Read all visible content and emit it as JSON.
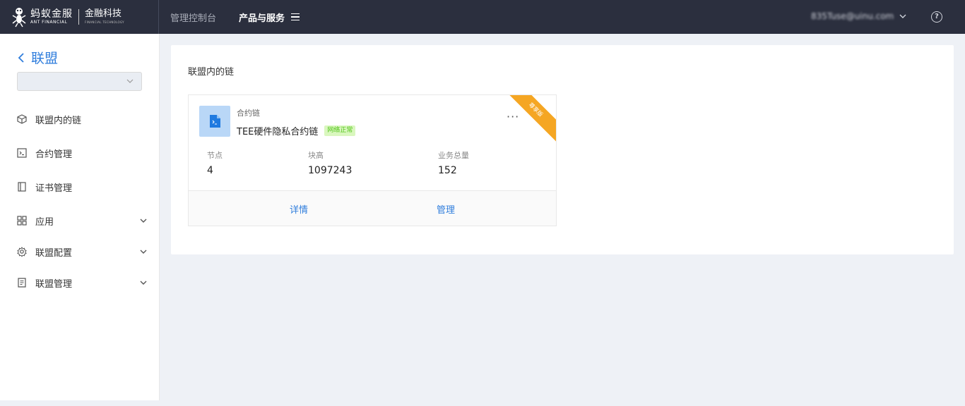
{
  "header": {
    "logo_cn": "蚂蚁金服",
    "logo_en": "ANT FINANCIAL",
    "logo_cn2": "金融科技",
    "logo_en2": "FINANCIAL TECHNOLOGY",
    "nav": [
      "管理控制台",
      "产品与服务"
    ],
    "user": "835Tuse@uinu.com",
    "help_icon": "?"
  },
  "sidebar": {
    "back_label": "联盟",
    "select_value": "",
    "items": [
      {
        "label": "联盟内的链",
        "icon": "cube-icon"
      },
      {
        "label": "合约管理",
        "icon": "terminal-icon"
      },
      {
        "label": "证书管理",
        "icon": "book-icon"
      },
      {
        "label": "应用",
        "icon": "grid-icon",
        "expandable": true
      },
      {
        "label": "联盟配置",
        "icon": "gear-icon",
        "expandable": true
      },
      {
        "label": "联盟管理",
        "icon": "document-icon",
        "expandable": true
      }
    ]
  },
  "main": {
    "title": "联盟内的链",
    "card": {
      "type": "合约链",
      "name": "TEE硬件隐私合约链",
      "status": "网络正常",
      "more": "···",
      "ribbon": "尊享版",
      "stats": [
        {
          "label": "节点",
          "value": "4"
        },
        {
          "label": "块高",
          "value": "1097243"
        },
        {
          "label": "业务总量",
          "value": "152"
        }
      ],
      "actions": [
        "详情",
        "管理"
      ]
    }
  },
  "colors": {
    "topbar": "#2b2f3e",
    "accent": "#2f7ddc",
    "ribbon": "#f5a623",
    "status_bg": "#d9f7be",
    "status_text": "#52c41a"
  }
}
